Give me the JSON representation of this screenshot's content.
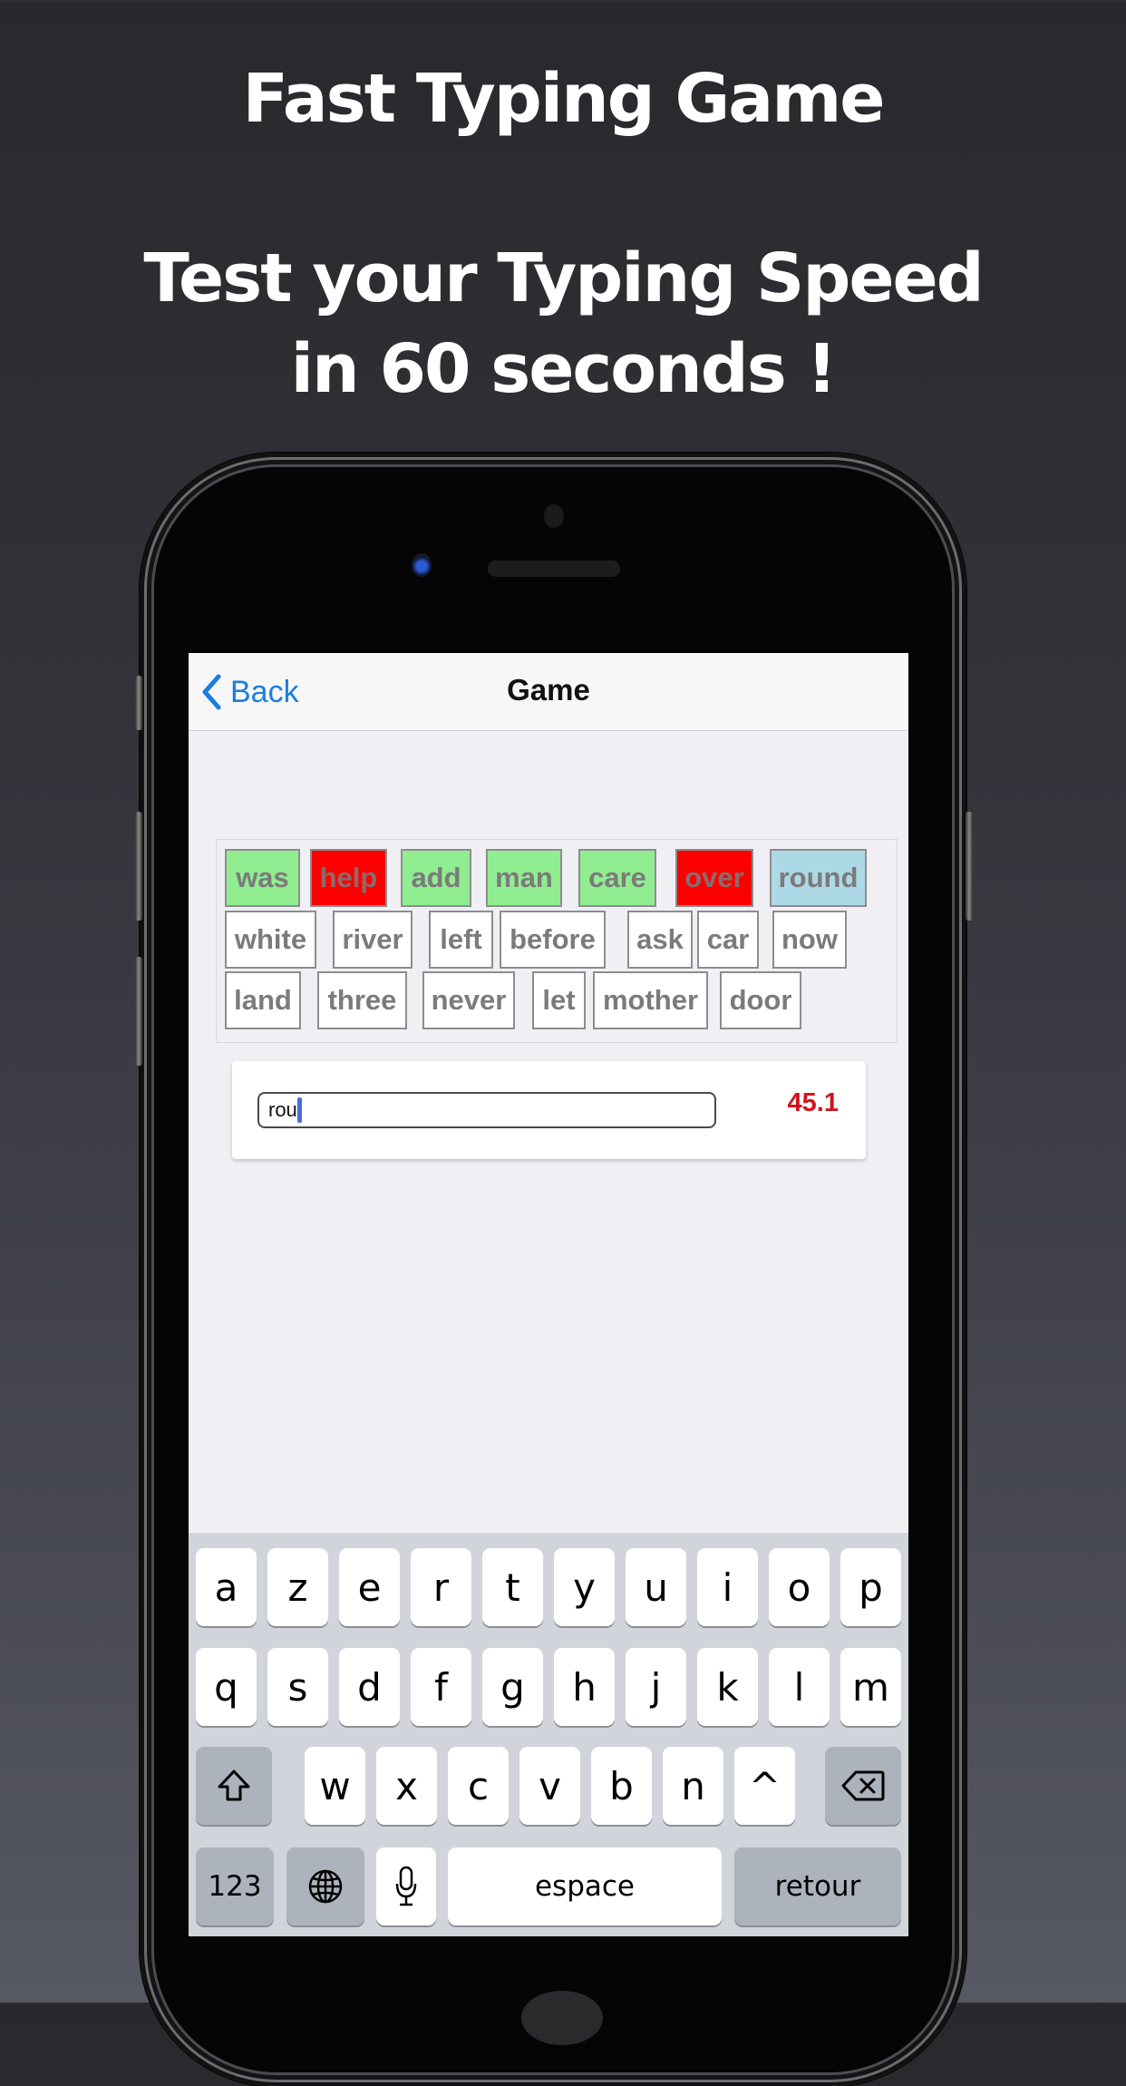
{
  "promo": {
    "title": "Fast Typing Game",
    "subtitle_line1": "Test your Typing Speed",
    "subtitle_line2": "in 60 seconds !"
  },
  "navbar": {
    "back_label": "Back",
    "back_icon": "chevron-left-icon",
    "title": "Game"
  },
  "colors": {
    "correct": "#90ee90",
    "wrong": "#ff0000",
    "current": "#add8e6",
    "pending": "#ffffff",
    "accent": "#1a7de0",
    "timer": "#d0141e"
  },
  "words": [
    {
      "text": "was",
      "state": "correct"
    },
    {
      "text": "help",
      "state": "wrong"
    },
    {
      "text": "add",
      "state": "correct"
    },
    {
      "text": "man",
      "state": "correct"
    },
    {
      "text": "care",
      "state": "correct"
    },
    {
      "text": "over",
      "state": "wrong"
    },
    {
      "text": "round",
      "state": "current"
    },
    {
      "text": "white",
      "state": "pending"
    },
    {
      "text": "river",
      "state": "pending"
    },
    {
      "text": "left",
      "state": "pending"
    },
    {
      "text": "before",
      "state": "pending"
    },
    {
      "text": "ask",
      "state": "pending"
    },
    {
      "text": "car",
      "state": "pending"
    },
    {
      "text": "now",
      "state": "pending"
    },
    {
      "text": "land",
      "state": "pending"
    },
    {
      "text": "three",
      "state": "pending"
    },
    {
      "text": "never",
      "state": "pending"
    },
    {
      "text": "let",
      "state": "pending"
    },
    {
      "text": "mother",
      "state": "pending"
    },
    {
      "text": "door",
      "state": "pending"
    }
  ],
  "input": {
    "value": "rou",
    "placeholder": ""
  },
  "timer": "45.1",
  "keyboard": {
    "row1": [
      "a",
      "z",
      "e",
      "r",
      "t",
      "y",
      "u",
      "i",
      "o",
      "p"
    ],
    "row2": [
      "q",
      "s",
      "d",
      "f",
      "g",
      "h",
      "j",
      "k",
      "l",
      "m"
    ],
    "row3": [
      "w",
      "x",
      "c",
      "v",
      "b",
      "n",
      "^"
    ],
    "shift_icon": "shift-icon",
    "delete_icon": "backspace-icon",
    "numbers_label": "123",
    "globe_icon": "globe-icon",
    "mic_icon": "microphone-icon",
    "space_label": "espace",
    "return_label": "retour"
  }
}
